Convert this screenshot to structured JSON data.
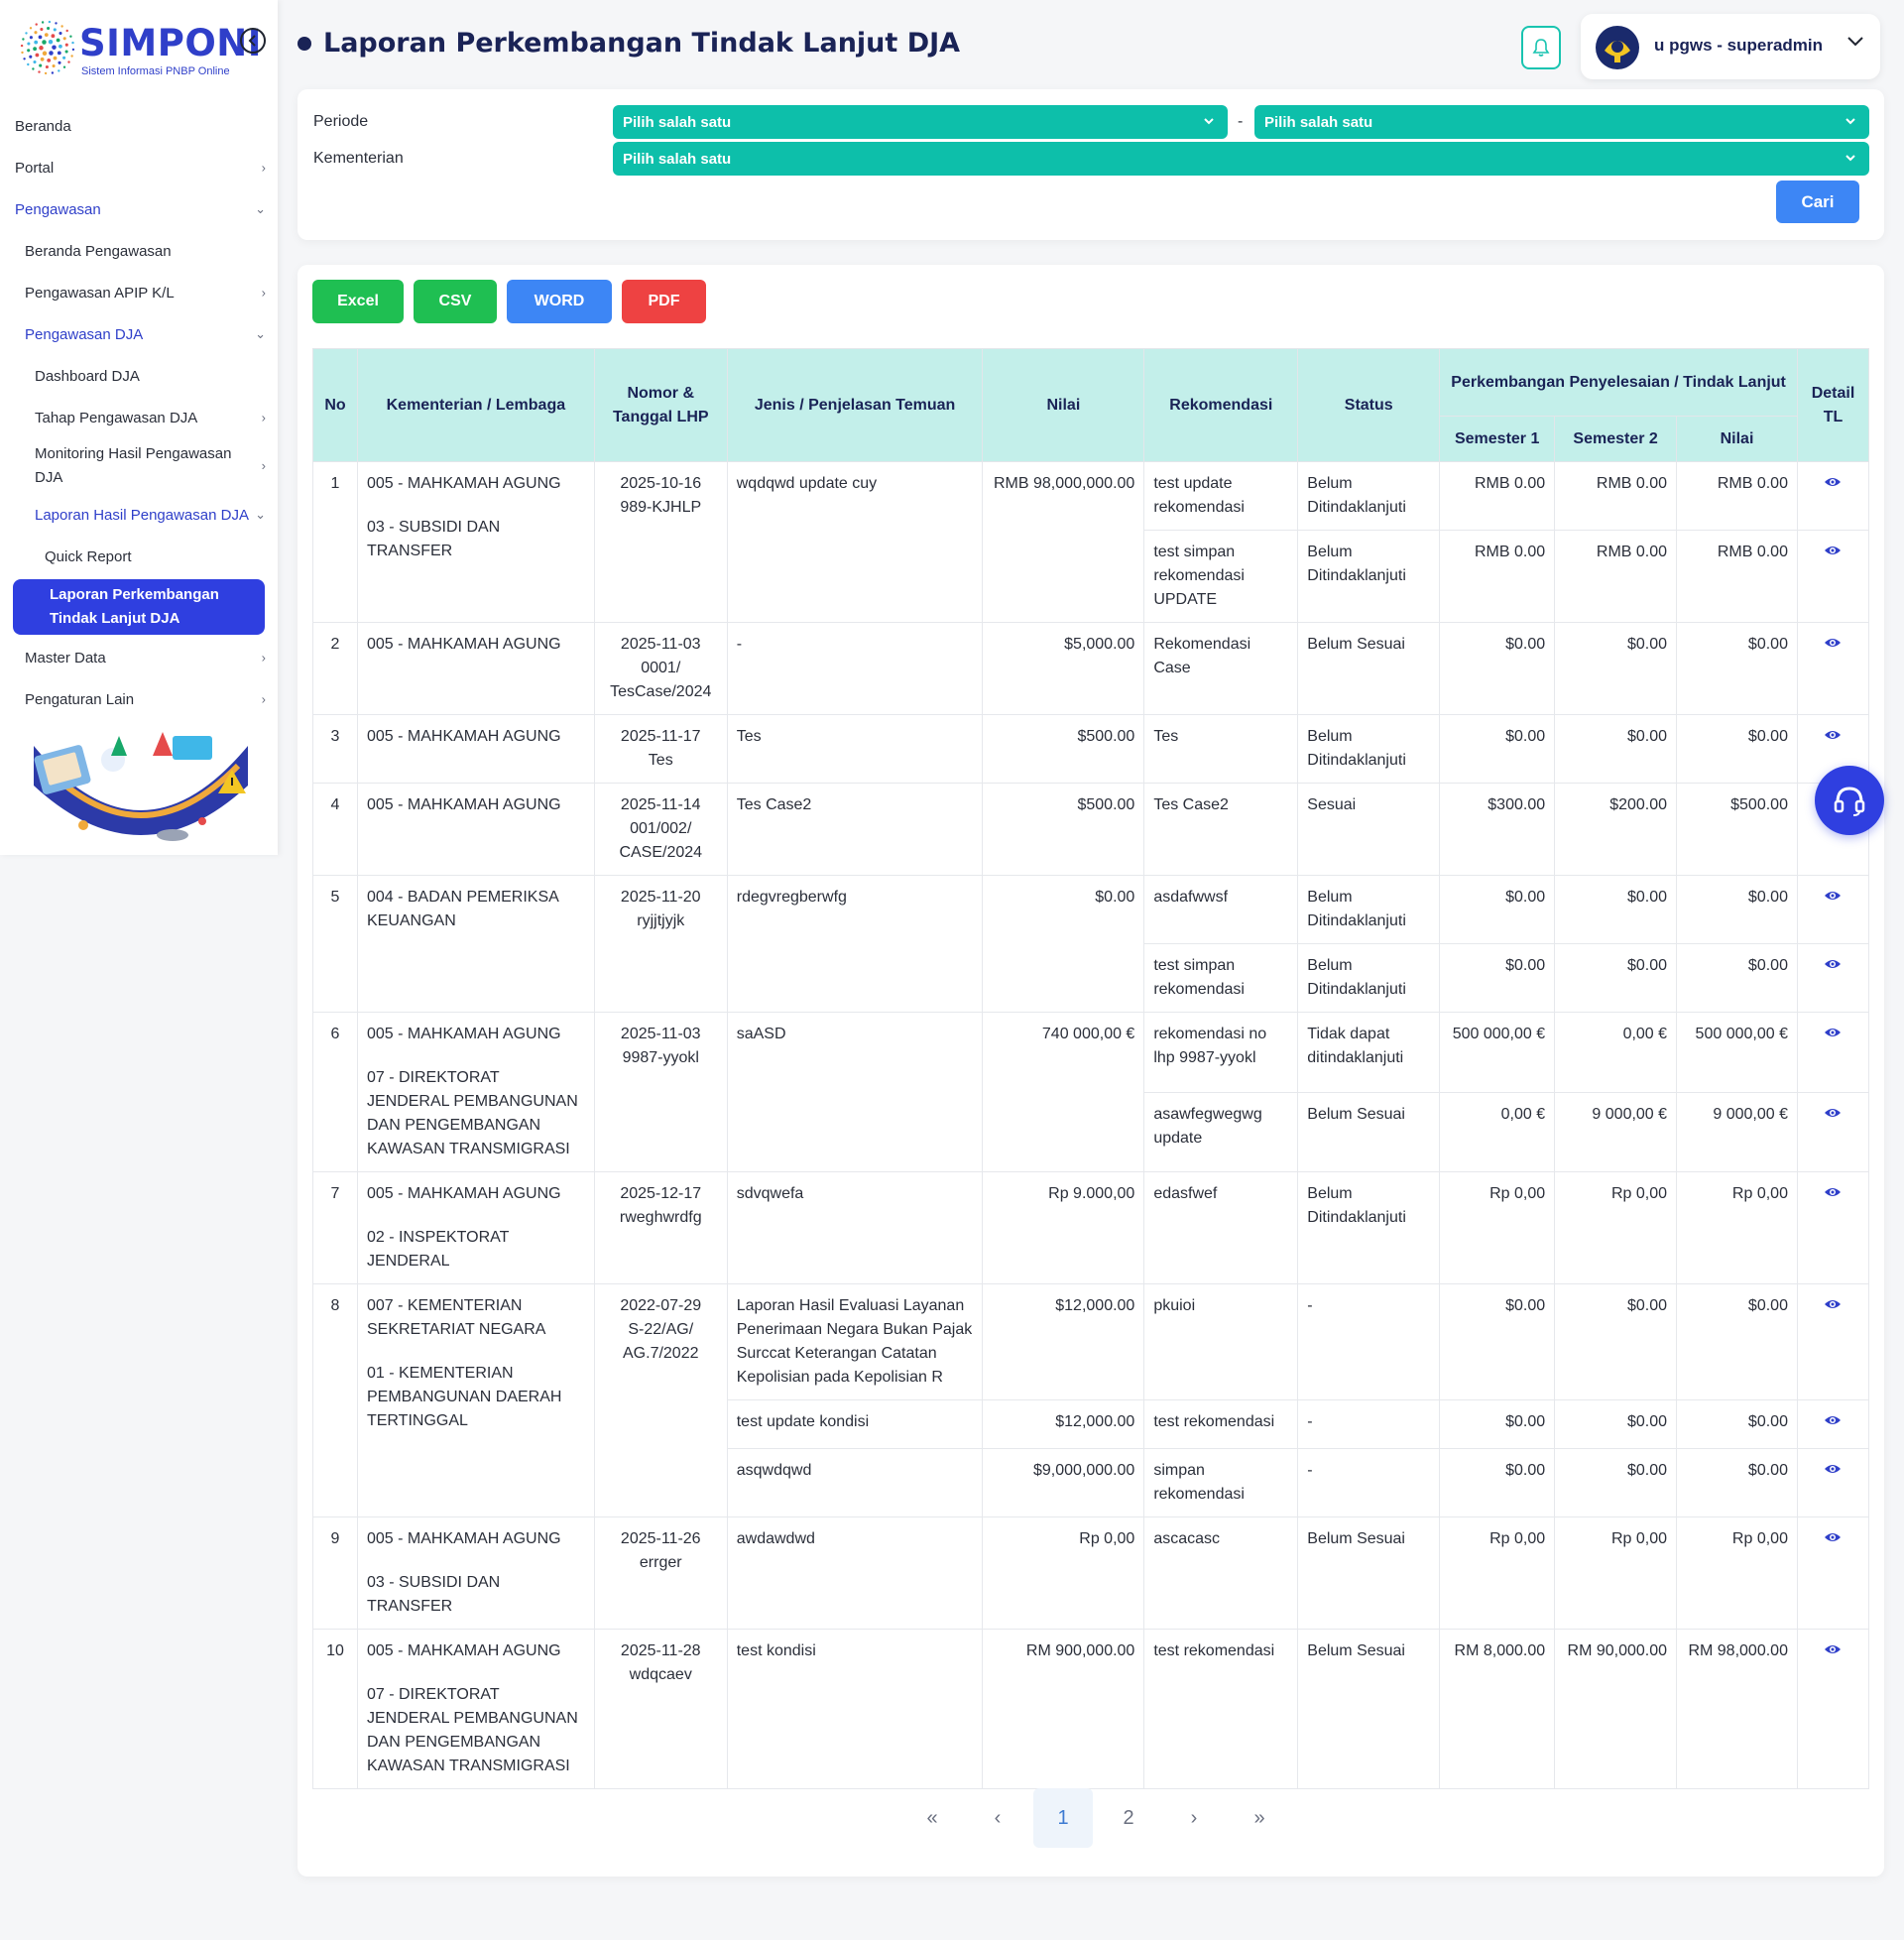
{
  "brand": {
    "name": "SIMPONI",
    "subtitle": "Sistem Informasi PNBP Online"
  },
  "sidebar": {
    "items": [
      {
        "label": "Beranda"
      },
      {
        "label": "Portal"
      },
      {
        "label": "Pengawasan"
      },
      {
        "label": "Beranda Pengawasan"
      },
      {
        "label": "Pengawasan APIP K/L"
      },
      {
        "label": "Pengawasan DJA"
      },
      {
        "label": "Dashboard DJA"
      },
      {
        "label": "Tahap Pengawasan DJA"
      },
      {
        "label": "Monitoring Hasil Pengawasan DJA"
      },
      {
        "label": "Laporan Hasil Pengawasan DJA"
      },
      {
        "label": "Quick Report"
      },
      {
        "label": "Laporan Perkembangan Tindak Lanjut DJA"
      },
      {
        "label": "Master Data"
      },
      {
        "label": "Pengaturan Lain"
      }
    ]
  },
  "header": {
    "title": "Laporan Perkembangan Tindak Lanjut DJA",
    "user": "u pgws - superadmin"
  },
  "filter": {
    "periode_label": "Periode",
    "kementerian_label": "Kementerian",
    "periode_from": "Pilih salah satu",
    "separator": "-",
    "periode_to": "Pilih salah satu",
    "kementerian": "Pilih salah satu",
    "search_button": "Cari"
  },
  "export": {
    "excel": "Excel",
    "csv": "CSV",
    "word": "WORD",
    "pdf": "PDF"
  },
  "table": {
    "headers": {
      "no": "No",
      "kementerian": "Kementerian / Lembaga",
      "nomor": "Nomor & Tanggal LHP",
      "jenis": "Jenis / Penjelasan Temuan",
      "nilai": "Nilai",
      "rekomendasi": "Rekomendasi",
      "status": "Status",
      "perkembangan": "Perkembangan Penyelesaian / Tindak Lanjut",
      "semester1": "Semester 1",
      "semester2": "Semester 2",
      "nilai_tl": "Nilai",
      "detail": "Detail TL"
    },
    "rows": [
      {
        "no": "1",
        "kl1": "005 - MAHKAMAH AGUNG",
        "kl2": "03 - SUBSIDI DAN TRANSFER",
        "lhp_date": "2025-10-16",
        "lhp_no": "989-KJHLP",
        "findings": [
          {
            "jenis": "wqdqwd update cuy",
            "nilai": "RMB 98,000,000.00",
            "recs": [
              {
                "rek": "test update rekomendasi",
                "status": "Belum Ditindaklanjuti",
                "s1": "RMB 0.00",
                "s2": "RMB 0.00",
                "nilai": "RMB 0.00"
              },
              {
                "rek": "test simpan rekomendasi UPDATE",
                "status": "Belum Ditindaklanjuti",
                "s1": "RMB 0.00",
                "s2": "RMB 0.00",
                "nilai": "RMB 0.00"
              }
            ]
          }
        ]
      },
      {
        "no": "2",
        "kl1": "005 - MAHKAMAH AGUNG",
        "kl2": "",
        "lhp_date": "2025-11-03",
        "lhp_no": "0001/ TesCase/2024",
        "findings": [
          {
            "jenis": "-",
            "nilai": "$5,000.00",
            "recs": [
              {
                "rek": "Rekomendasi Case",
                "status": "Belum Sesuai",
                "s1": "$0.00",
                "s2": "$0.00",
                "nilai": "$0.00"
              }
            ]
          }
        ]
      },
      {
        "no": "3",
        "kl1": "005 - MAHKAMAH AGUNG",
        "kl2": "",
        "lhp_date": "2025-11-17",
        "lhp_no": "Tes",
        "findings": [
          {
            "jenis": "Tes",
            "nilai": "$500.00",
            "recs": [
              {
                "rek": "Tes",
                "status": "Belum Ditindaklanjuti",
                "s1": "$0.00",
                "s2": "$0.00",
                "nilai": "$0.00"
              }
            ]
          }
        ]
      },
      {
        "no": "4",
        "kl1": "005 - MAHKAMAH AGUNG",
        "kl2": "",
        "lhp_date": "2025-11-14",
        "lhp_no": "001/002/ CASE/2024",
        "findings": [
          {
            "jenis": "Tes Case2",
            "nilai": "$500.00",
            "recs": [
              {
                "rek": "Tes Case2",
                "status": "Sesuai",
                "s1": "$300.00",
                "s2": "$200.00",
                "nilai": "$500.00"
              }
            ]
          }
        ]
      },
      {
        "no": "5",
        "kl1": "004 - BADAN PEMERIKSA KEUANGAN",
        "kl2": "",
        "lhp_date": "2025-11-20",
        "lhp_no": "ryjjtjyjk",
        "findings": [
          {
            "jenis": "rdegvregberwfg",
            "nilai": "$0.00",
            "recs": [
              {
                "rek": "asdafwwsf",
                "status": "Belum Ditindaklanjuti",
                "s1": "$0.00",
                "s2": "$0.00",
                "nilai": "$0.00"
              },
              {
                "rek": "test simpan rekomendasi",
                "status": "Belum Ditindaklanjuti",
                "s1": "$0.00",
                "s2": "$0.00",
                "nilai": "$0.00"
              }
            ]
          }
        ]
      },
      {
        "no": "6",
        "kl1": "005 - MAHKAMAH AGUNG",
        "kl2": "07 - DIREKTORAT JENDERAL PEMBANGUNAN DAN PENGEMBANGAN KAWASAN TRANSMIGRASI",
        "lhp_date": "2025-11-03",
        "lhp_no": "9987-yyokl",
        "findings": [
          {
            "jenis": "saASD",
            "nilai": "740 000,00 €",
            "recs": [
              {
                "rek": "rekomendasi no lhp 9987-yyokl",
                "status": "Tidak dapat ditindaklanjuti",
                "s1": "500 000,00 €",
                "s2": "0,00 €",
                "nilai": "500 000,00 €"
              },
              {
                "rek": "asawfegwegwg update",
                "status": "Belum Sesuai",
                "s1": "0,00 €",
                "s2": "9 000,00 €",
                "nilai": "9 000,00 €"
              }
            ]
          }
        ]
      },
      {
        "no": "7",
        "kl1": "005 - MAHKAMAH AGUNG",
        "kl2": "02 - INSPEKTORAT JENDERAL",
        "lhp_date": "2025-12-17",
        "lhp_no": "rweghwrdfg",
        "findings": [
          {
            "jenis": "sdvqwefa",
            "nilai": "Rp 9.000,00",
            "recs": [
              {
                "rek": "edasfwef",
                "status": "Belum Ditindaklanjuti",
                "s1": "Rp 0,00",
                "s2": "Rp 0,00",
                "nilai": "Rp 0,00"
              }
            ]
          }
        ]
      },
      {
        "no": "8",
        "kl1": "007 - KEMENTERIAN SEKRETARIAT NEGARA",
        "kl2": "01 - KEMENTERIAN PEMBANGUNAN DAERAH TERTINGGAL",
        "lhp_date": "2022-07-29",
        "lhp_no": "S-22/AG/ AG.7/2022",
        "findings": [
          {
            "jenis": "Laporan Hasil Evaluasi Layanan Penerimaan Negara Bukan Pajak Surccat Keterangan Catatan Kepolisian pada Kepolisian R",
            "nilai": "$12,000.00",
            "recs": [
              {
                "rek": "pkuioi",
                "status": "-",
                "s1": "$0.00",
                "s2": "$0.00",
                "nilai": "$0.00"
              }
            ]
          },
          {
            "jenis": "test update kondisi",
            "nilai": "$12,000.00",
            "recs": [
              {
                "rek": "test rekomendasi",
                "status": "-",
                "s1": "$0.00",
                "s2": "$0.00",
                "nilai": "$0.00"
              }
            ]
          },
          {
            "jenis": "asqwdqwd",
            "nilai": "$9,000,000.00",
            "recs": [
              {
                "rek": "simpan rekomendasi",
                "status": "-",
                "s1": "$0.00",
                "s2": "$0.00",
                "nilai": "$0.00"
              }
            ]
          }
        ]
      },
      {
        "no": "9",
        "kl1": "005 - MAHKAMAH AGUNG",
        "kl2": "03 - SUBSIDI DAN TRANSFER",
        "lhp_date": "2025-11-26",
        "lhp_no": "errger",
        "findings": [
          {
            "jenis": "awdawdwd",
            "nilai": "Rp 0,00",
            "recs": [
              {
                "rek": "ascacasc",
                "status": "Belum Sesuai",
                "s1": "Rp 0,00",
                "s2": "Rp 0,00",
                "nilai": "Rp 0,00"
              }
            ]
          }
        ]
      },
      {
        "no": "10",
        "kl1": "005 - MAHKAMAH AGUNG",
        "kl2": "07 - DIREKTORAT JENDERAL PEMBANGUNAN DAN PENGEMBANGAN KAWASAN TRANSMIGRASI",
        "lhp_date": "2025-11-28",
        "lhp_no": "wdqcaev",
        "findings": [
          {
            "jenis": "test kondisi",
            "nilai": "RM 900,000.00",
            "recs": [
              {
                "rek": "test rekomendasi",
                "status": "Belum Sesuai",
                "s1": "RM 8,000.00",
                "s2": "RM 90,000.00",
                "nilai": "RM 98,000.00"
              }
            ]
          }
        ]
      }
    ]
  },
  "pagination": {
    "first": "«",
    "prev": "‹",
    "pages": [
      "1",
      "2"
    ],
    "current": "1",
    "next": "›",
    "last": "»"
  },
  "icons": {
    "detail": "eye-icon",
    "help": "headset-icon",
    "bell": "bell-icon"
  },
  "colors": {
    "primary": "#2f3fe0",
    "teal": "#0dbfaa",
    "header_bg": "#c3efea",
    "excel": "#1fbf52",
    "word": "#3d86f5",
    "pdf": "#ee4242"
  }
}
